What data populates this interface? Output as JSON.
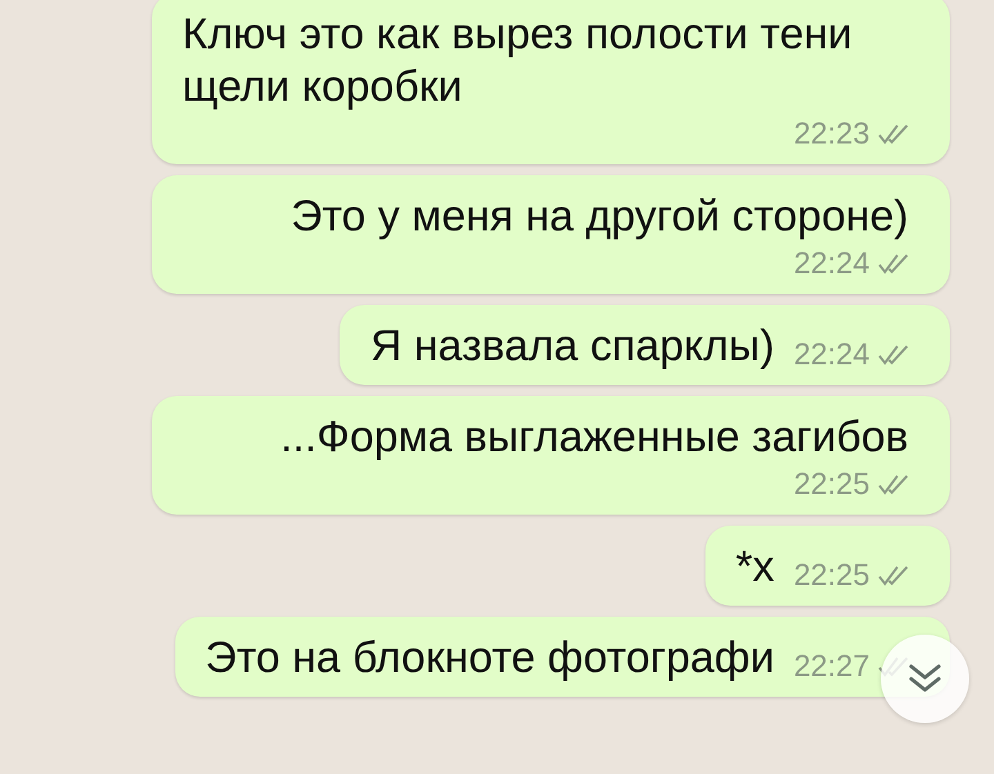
{
  "messages": [
    {
      "text": "Ключ это как вырез полости тени щели коробки",
      "time": "22:23",
      "read": false
    },
    {
      "text": "Это у меня на другой стороне)",
      "time": "22:24",
      "read": false
    },
    {
      "text": "Я назвала спарклы)",
      "time": "22:24",
      "read": false
    },
    {
      "text": "...Форма выглаженные загибов",
      "time": "22:25",
      "read": false
    },
    {
      "text": "*х",
      "time": "22:25",
      "read": false
    },
    {
      "text": "Это на блокноте фотографи",
      "time": "22:27",
      "read": false
    }
  ],
  "scroll_down_button": {
    "visible": true
  }
}
